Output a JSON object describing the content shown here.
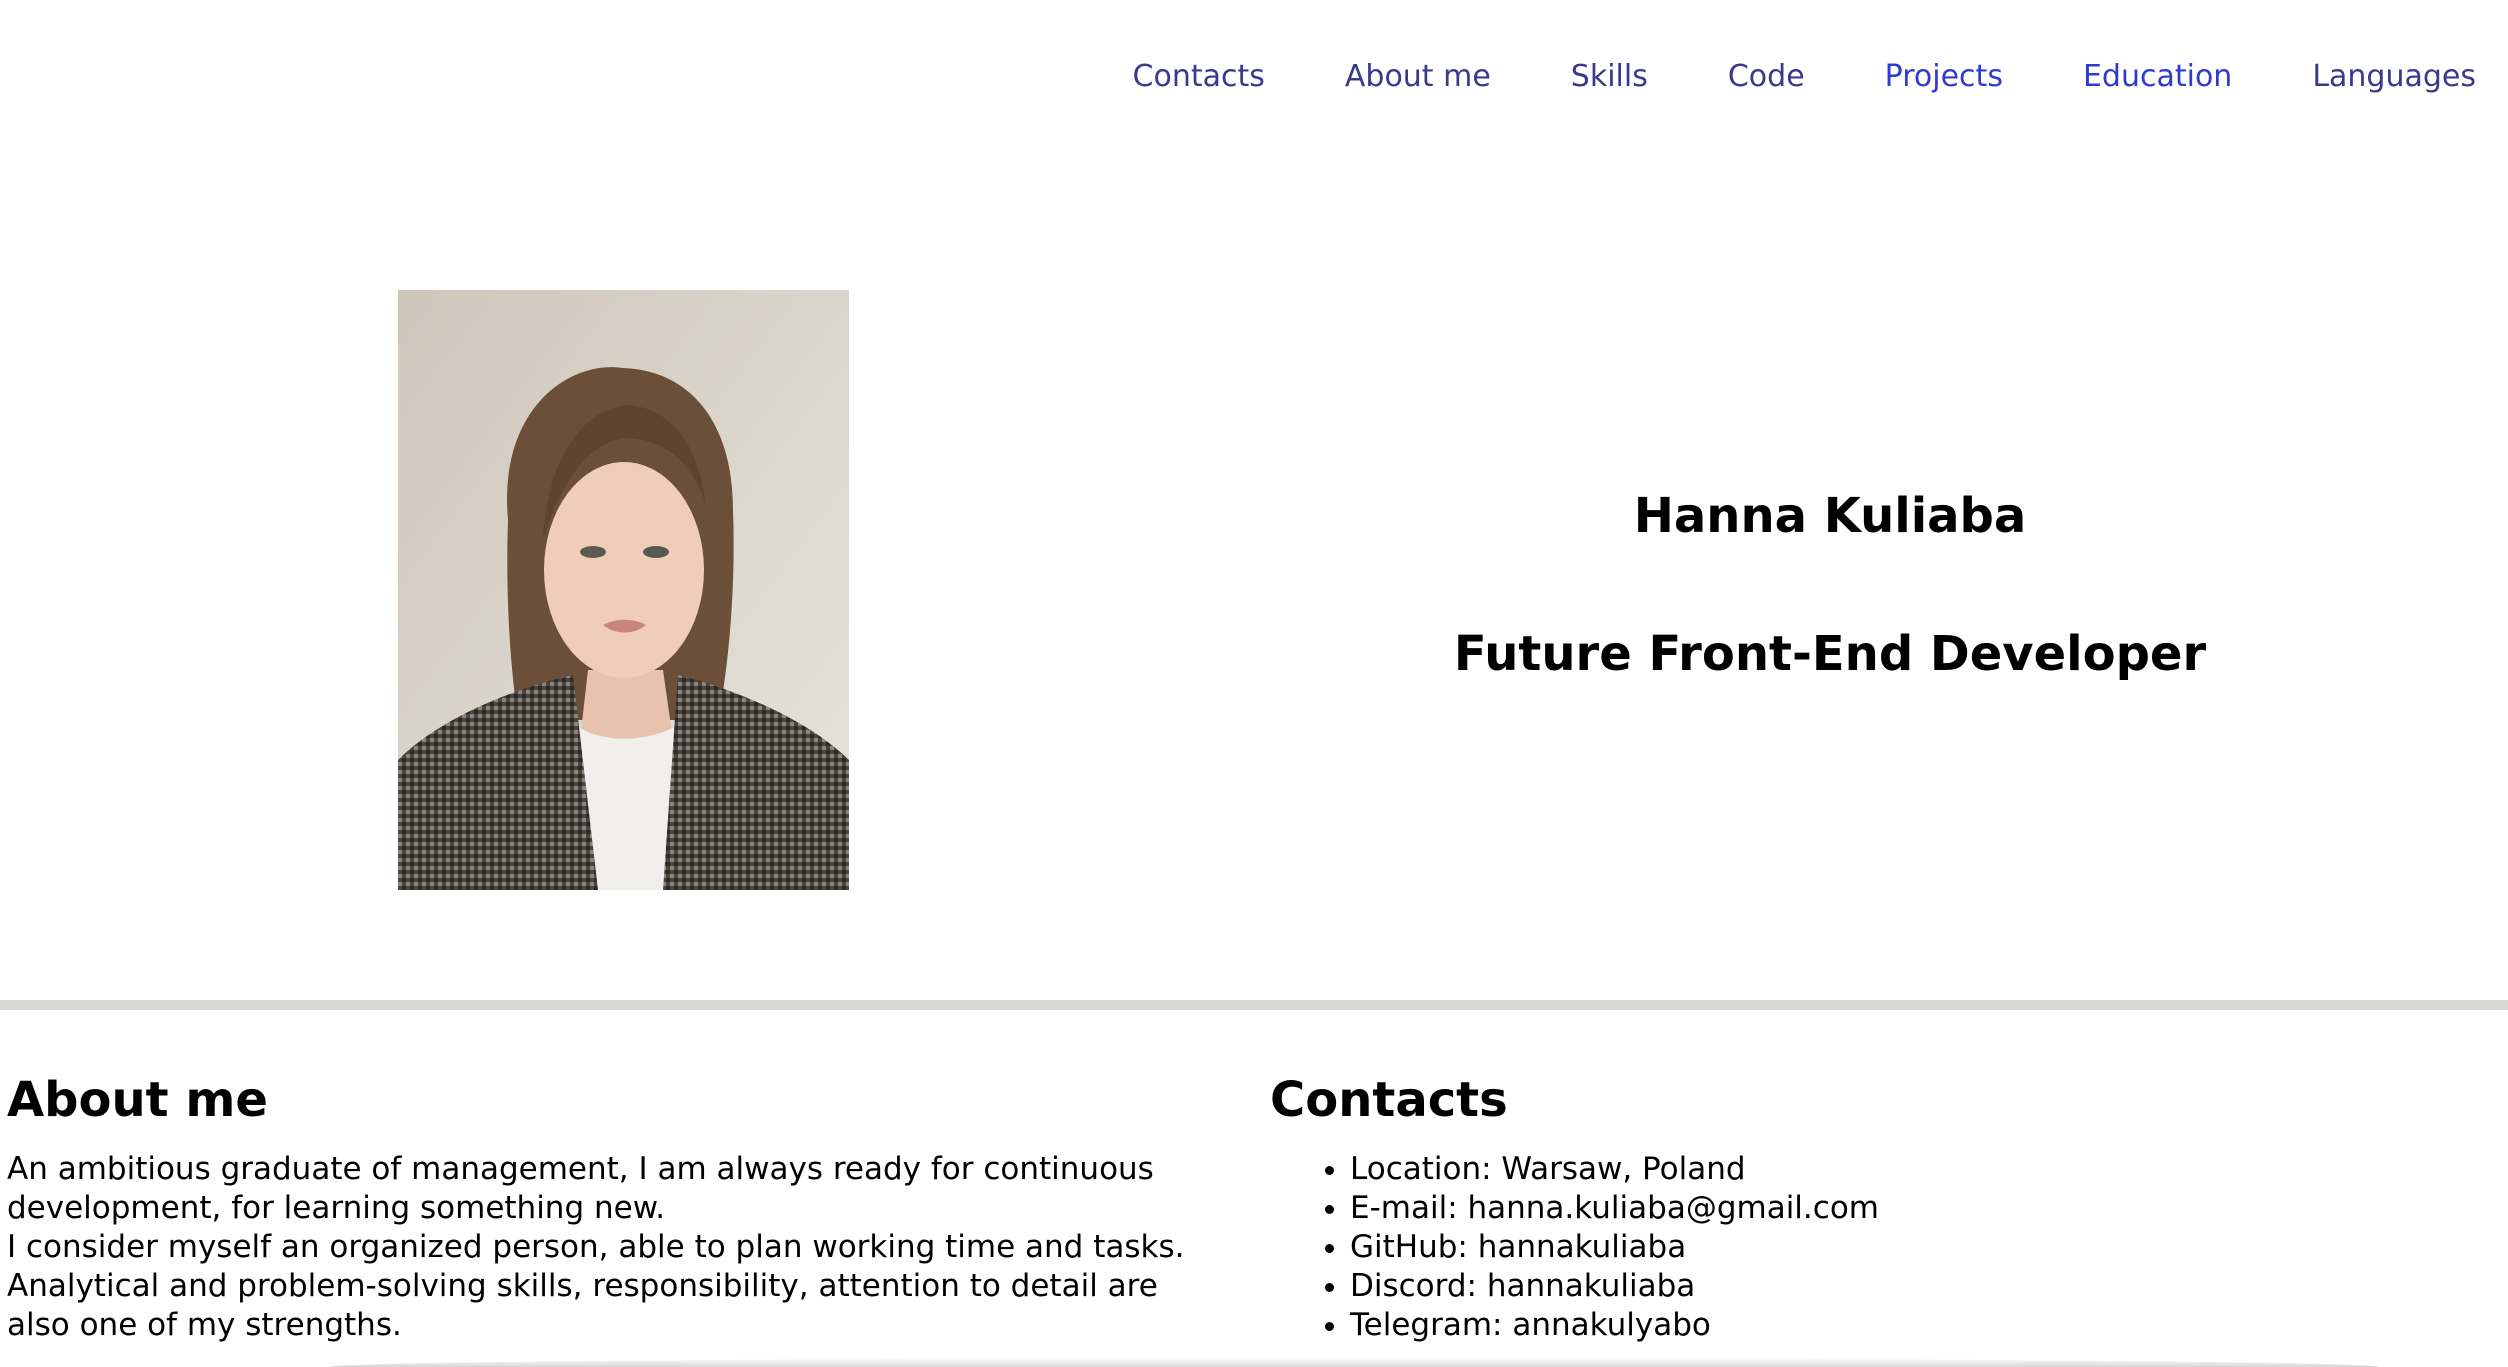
{
  "nav": {
    "items": [
      {
        "label": "Contacts"
      },
      {
        "label": "About me"
      },
      {
        "label": "Skills"
      },
      {
        "label": "Code"
      },
      {
        "label": "Projects"
      },
      {
        "label": "Education"
      },
      {
        "label": "Languages"
      }
    ]
  },
  "hero": {
    "name": "Hanna Kuliaba",
    "role": "Future Front-End Developer"
  },
  "about": {
    "title": "About me",
    "lines": [
      "An ambitious graduate of management, I am always ready for continuous",
      "development, for learning something new.",
      "I consider myself an organized person, able to plan working time and tasks.",
      "Analytical and problem-solving skills, responsibility, attention to detail are",
      "also one of my strengths."
    ]
  },
  "contacts": {
    "title": "Contacts",
    "items": [
      "Location: Warsaw, Poland",
      "E-mail: hanna.kuliaba@gmail.com",
      "GitHub: hannakuliaba",
      "Discord: hannakuliaba",
      "Telegram: annakulyabo"
    ]
  },
  "colors": {
    "nav_link": "#3a3a8c",
    "nav_link_active": "#2f3bd0",
    "divider": "#d9d8d0"
  }
}
